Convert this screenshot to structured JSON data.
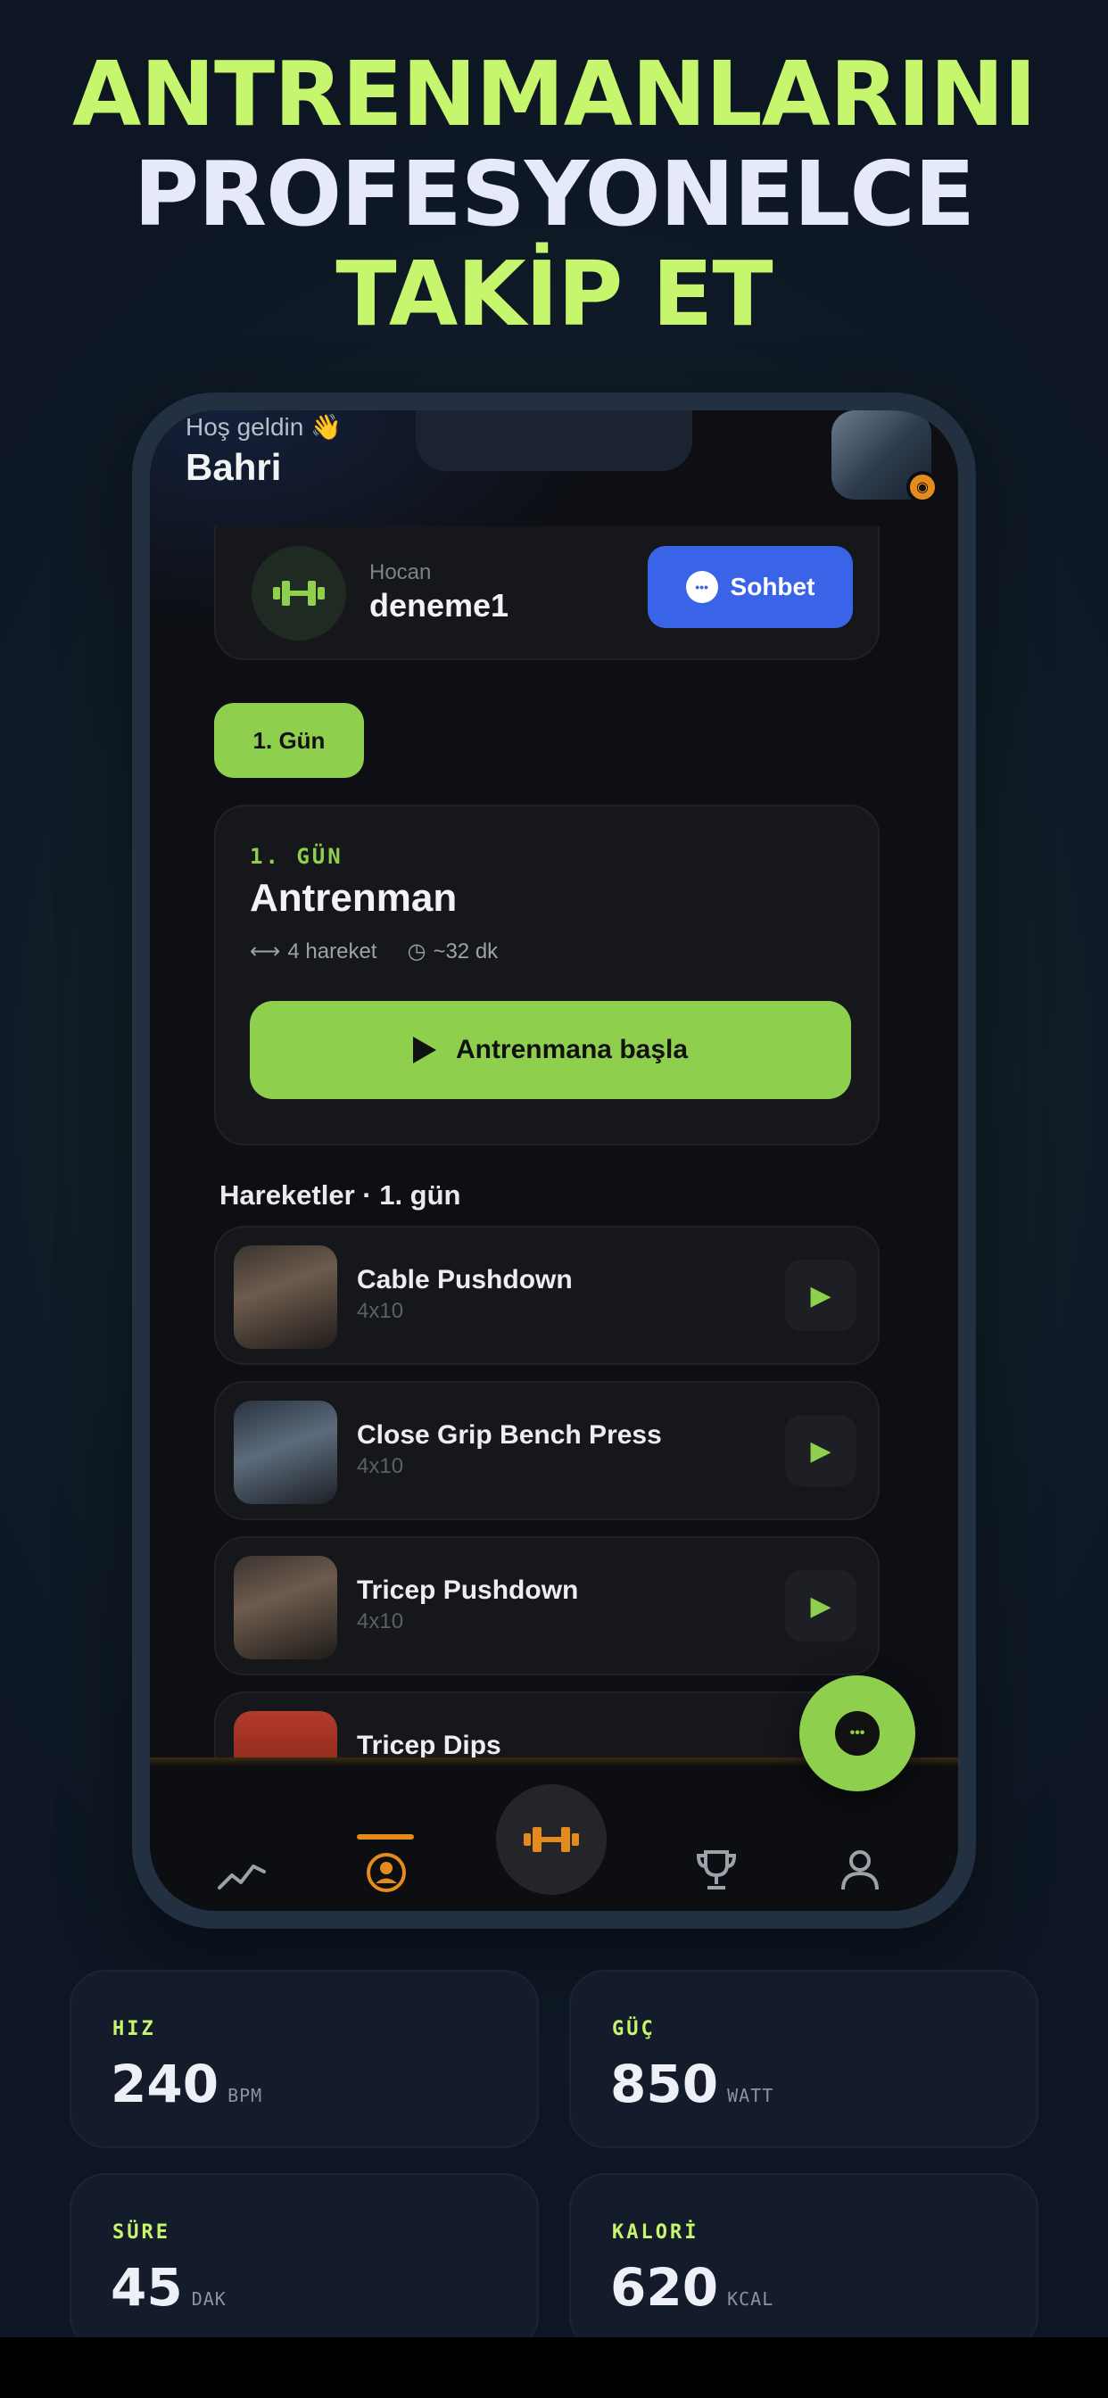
{
  "headline": {
    "line1": "ANTRENMANLARINI",
    "line2": "PROFESYONELCE",
    "line3": "TAKİP ET"
  },
  "app": {
    "greeting": "Hoş geldin 👋",
    "username": "Bahri",
    "coach": {
      "label": "Hocan",
      "name": "deneme1",
      "chat_button": "Sohbet"
    },
    "day_chip": "1. Gün",
    "workout": {
      "day_label": "1. GÜN",
      "title": "Antrenman",
      "moves": "4 hareket",
      "duration": "~32 dk",
      "start_button": "Antrenmana başla"
    },
    "section_title": "Hareketler · 1. gün",
    "exercises": [
      {
        "name": "Cable Pushdown",
        "sets": "4x10"
      },
      {
        "name": "Close Grip Bench Press",
        "sets": "4x10"
      },
      {
        "name": "Tricep Pushdown",
        "sets": "4x10"
      },
      {
        "name": "Tricep Dips",
        "sets": ""
      }
    ],
    "tabs": [
      "stats-icon",
      "profile-icon",
      "dumbbell-icon",
      "trophy-icon",
      "user-icon"
    ]
  },
  "stats": [
    {
      "label": "HIZ",
      "value": "240",
      "unit": "BPM"
    },
    {
      "label": "GÜÇ",
      "value": "850",
      "unit": "WATT"
    },
    {
      "label": "SÜRE",
      "value": "45",
      "unit": "DAK"
    },
    {
      "label": "KALORİ",
      "value": "620",
      "unit": "KCAL"
    }
  ],
  "colors": {
    "accent_green": "#8fcf4e",
    "headline_green": "#c6f66d",
    "chat_blue": "#3a64e8",
    "active_orange": "#e58b1e"
  }
}
